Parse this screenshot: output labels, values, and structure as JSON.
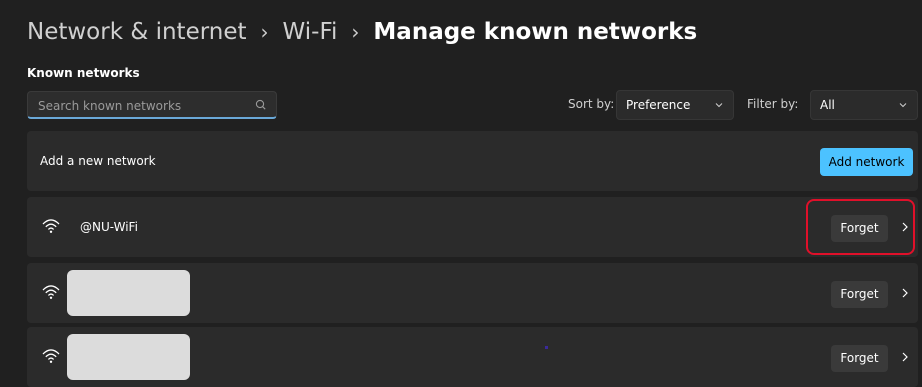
{
  "breadcrumb": {
    "items": [
      "Network & internet",
      "Wi-Fi",
      "Manage known networks"
    ],
    "separator": "›"
  },
  "section": {
    "title": "Known networks"
  },
  "search": {
    "placeholder": "Search known networks",
    "value": "",
    "icon": "search-icon"
  },
  "sort": {
    "label": "Sort by:",
    "value": "Preference"
  },
  "filter": {
    "label": "Filter by:",
    "value": "All"
  },
  "add_network": {
    "label": "Add a new network",
    "button_label": "Add network"
  },
  "networks": [
    {
      "name": "@NU-WiFi",
      "forget_label": "Forget",
      "redacted": false
    },
    {
      "name": "",
      "forget_label": "Forget",
      "redacted": true
    },
    {
      "name": "",
      "forget_label": "Forget",
      "redacted": true
    }
  ],
  "colors": {
    "background": "#202020",
    "card": "#2b2b2b",
    "accent": "#4cc2ff",
    "highlight": "#e0102a"
  }
}
